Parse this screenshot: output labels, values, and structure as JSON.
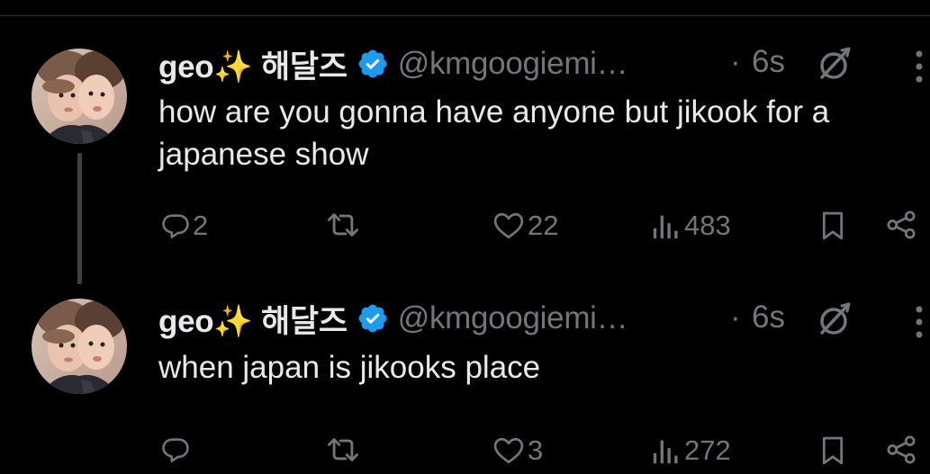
{
  "colors": {
    "background": "#000000",
    "text_primary": "#e7e9ea",
    "text_secondary": "#71767b",
    "verified_blue": "#1d9bf0",
    "thread_line": "#3e4144"
  },
  "tweets": [
    {
      "author": {
        "display_name": "geo✨ 해달즈",
        "handle": "@kmgoogiemi…",
        "verified": true
      },
      "separator": "·",
      "time": "6s",
      "text": "how are you gonna have anyone but jikook for a japanese show",
      "stats": {
        "replies": "2",
        "retweets": "",
        "likes": "22",
        "views": "483"
      },
      "icons": [
        "reply-icon",
        "retweet-icon",
        "like-icon",
        "views-icon",
        "bookmark-icon",
        "share-icon",
        "grok-icon",
        "more-icon"
      ]
    },
    {
      "author": {
        "display_name": "geo✨ 해달즈",
        "handle": "@kmgoogiemi…",
        "verified": true
      },
      "separator": "·",
      "time": "6s",
      "text": "when japan is jikooks place",
      "stats": {
        "replies": "",
        "retweets": "",
        "likes": "3",
        "views": "272"
      },
      "icons": [
        "reply-icon",
        "retweet-icon",
        "like-icon",
        "views-icon",
        "bookmark-icon",
        "share-icon",
        "grok-icon",
        "more-icon"
      ]
    }
  ]
}
